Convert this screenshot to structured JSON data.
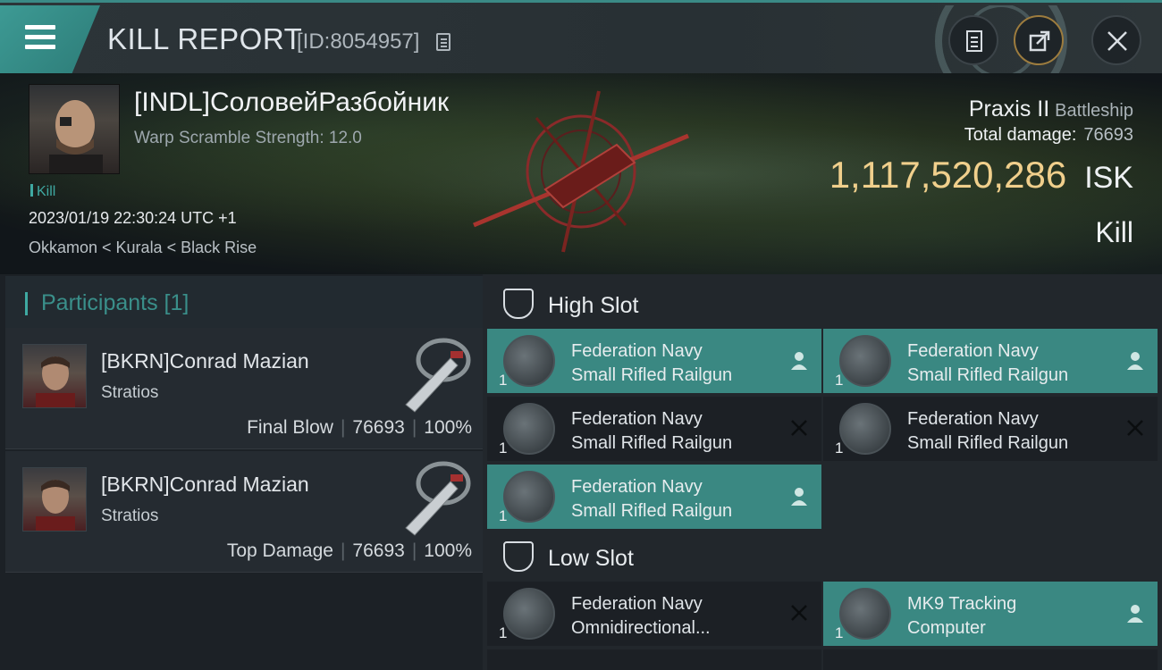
{
  "header": {
    "title": "KILL REPORT",
    "kill_id": "[ID:8054957]",
    "icons": [
      "menu-icon",
      "copy-icon",
      "report-icon",
      "share-icon",
      "close-icon"
    ]
  },
  "victim": {
    "name": "[INDL]СоловейРазбойник",
    "scram": "Warp Scramble Strength: 12.0",
    "tag": "Kill",
    "time": "2023/01/19 22:30:24 UTC +1",
    "location": "Okkamon < Kurala < Black Rise",
    "ship": "Praxis II",
    "ship_class": "Battleship",
    "total_damage_label": "Total damage:",
    "total_damage": "76693",
    "isk_value": "1,117,520,286",
    "isk_unit": "ISK",
    "kill_type": "Kill"
  },
  "participants": {
    "title": "Participants [1]",
    "rows": [
      {
        "name": "[BKRN]Conrad Mazian",
        "ship": "Stratios",
        "role": "Final Blow",
        "damage": "76693",
        "percent": "100%"
      },
      {
        "name": "[BKRN]Conrad Mazian",
        "ship": "Stratios",
        "role": "Top Damage",
        "damage": "76693",
        "percent": "100%"
      }
    ]
  },
  "slots": {
    "high": {
      "label": "High Slot",
      "modules": [
        {
          "line1": "Federation Navy",
          "line2": "Small Rifled Railgun",
          "qty": "1",
          "status": "dropped"
        },
        {
          "line1": "Federation Navy",
          "line2": "Small Rifled Railgun",
          "qty": "1",
          "status": "dropped"
        },
        {
          "line1": "Federation Navy",
          "line2": "Small Rifled Railgun",
          "qty": "1",
          "status": "destroyed"
        },
        {
          "line1": "Federation Navy",
          "line2": "Small Rifled Railgun",
          "qty": "1",
          "status": "destroyed"
        },
        {
          "line1": "Federation Navy",
          "line2": "Small Rifled Railgun",
          "qty": "1",
          "status": "dropped"
        }
      ]
    },
    "low": {
      "label": "Low Slot",
      "modules": [
        {
          "line1": "Federation Navy",
          "line2": "Omnidirectional...",
          "qty": "1",
          "status": "destroyed"
        },
        {
          "line1": "MK9 Tracking",
          "line2": "Computer",
          "qty": "1",
          "status": "dropped"
        }
      ]
    }
  },
  "colors": {
    "accent": "#3fa9a2",
    "dropped": "#3a8882",
    "isk": "#f0cf8c"
  }
}
